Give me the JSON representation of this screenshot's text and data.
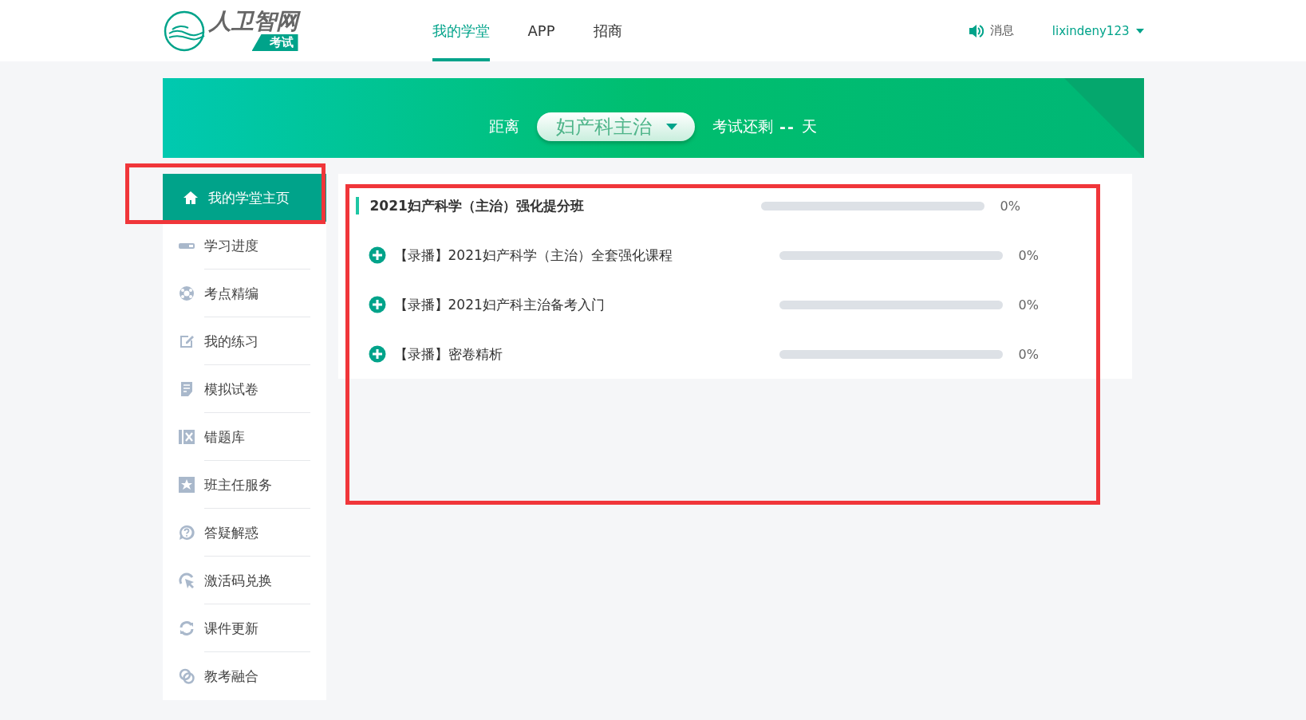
{
  "header": {
    "logo": {
      "brand": "人卫智网",
      "tag": "考试"
    },
    "nav": [
      {
        "label": "我的学堂",
        "selected": true
      },
      {
        "label": "APP",
        "selected": false
      },
      {
        "label": "招商",
        "selected": false
      }
    ],
    "messages": "消息",
    "user": "lixindeny123"
  },
  "banner": {
    "prefix": "距离",
    "exam": "妇产科主治",
    "suffix": "考试还剩",
    "days": "--",
    "unit": "天"
  },
  "sidebar": {
    "items": [
      {
        "label": "我的学堂主页",
        "selected": true,
        "highlighted": true
      },
      {
        "label": "学习进度",
        "selected": false,
        "highlighted": false
      },
      {
        "label": "考点精编",
        "selected": false,
        "highlighted": false
      },
      {
        "label": "我的练习",
        "selected": false,
        "highlighted": false
      },
      {
        "label": "模拟试卷",
        "selected": false,
        "highlighted": false
      },
      {
        "label": "错题库",
        "selected": false,
        "highlighted": false
      },
      {
        "label": "班主任服务",
        "selected": false,
        "highlighted": false
      },
      {
        "label": "答疑解惑",
        "selected": false,
        "highlighted": false
      },
      {
        "label": "激活码兑换",
        "selected": false,
        "highlighted": false
      },
      {
        "label": "课件更新",
        "selected": false,
        "highlighted": false
      },
      {
        "label": "教考融合",
        "selected": false,
        "highlighted": false
      }
    ]
  },
  "course_panel": {
    "highlighted": true,
    "title": "2021妇产科学（主治）强化提分班",
    "level": 0,
    "percent": "0%",
    "courses": [
      {
        "title": "【录播】2021妇产科学（主治）全套强化课程",
        "level": 0,
        "percent": "0%"
      },
      {
        "title": "【录播】2021妇产科主治备考入门",
        "level": 0,
        "percent": "0%"
      },
      {
        "title": "【录播】密卷精析",
        "level": 0,
        "percent": "0%"
      }
    ]
  }
}
